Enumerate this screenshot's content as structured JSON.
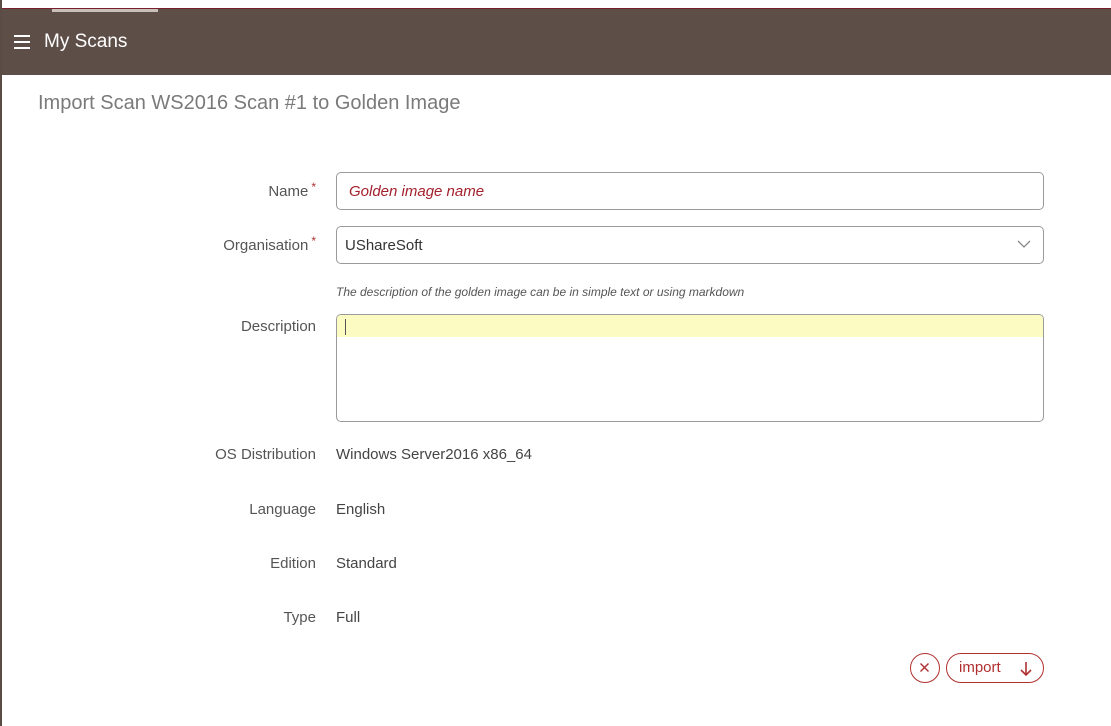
{
  "header": {
    "title": "My Scans",
    "menu_icon": "hamburger-menu-icon"
  },
  "page": {
    "title": "Import Scan WS2016 Scan #1 to Golden Image"
  },
  "form": {
    "name": {
      "label": "Name",
      "required_mark": "*",
      "placeholder": "Golden image name",
      "value": ""
    },
    "organisation": {
      "label": "Organisation",
      "required_mark": "*",
      "selected": "UShareSoft",
      "icon": "chevron-down-icon"
    },
    "description": {
      "label": "Description",
      "hint": "The description of the golden image can be in simple text or using markdown",
      "value": ""
    },
    "os_distribution": {
      "label": "OS Distribution",
      "value": "Windows Server2016 x86_64"
    },
    "language": {
      "label": "Language",
      "value": "English"
    },
    "edition": {
      "label": "Edition",
      "value": "Standard"
    },
    "type": {
      "label": "Type",
      "value": "Full"
    }
  },
  "actions": {
    "cancel_icon": "close-icon",
    "import_label": "import",
    "import_icon": "arrow-down-icon"
  },
  "colors": {
    "header_bg": "#5e4e48",
    "accent": "#b03030",
    "description_highlight": "#fbfbc2"
  }
}
